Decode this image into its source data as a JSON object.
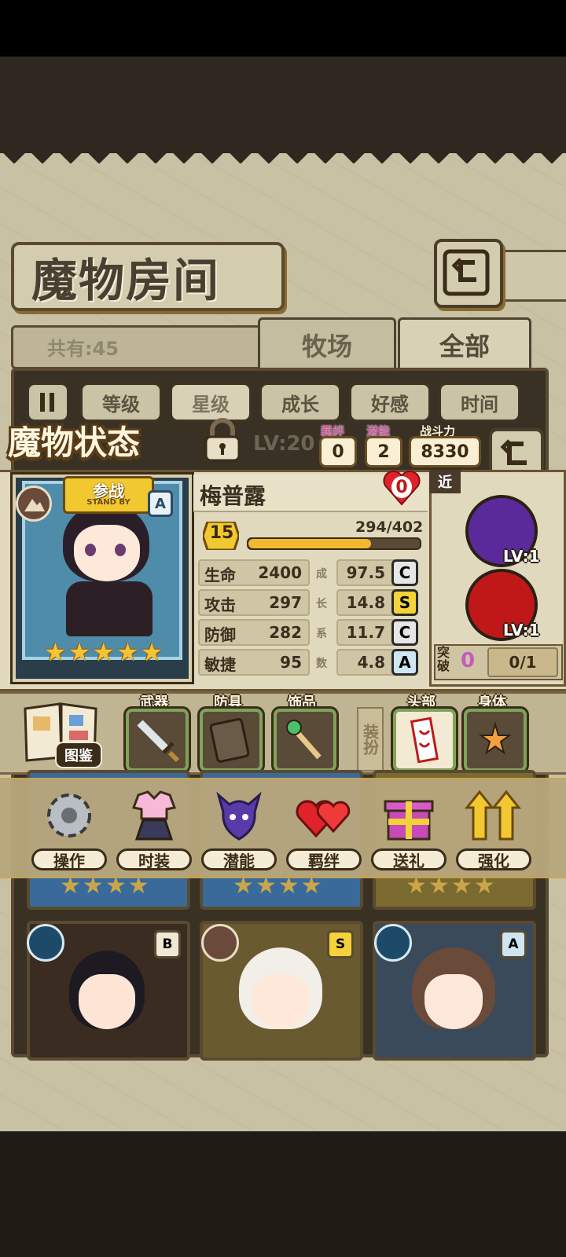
{
  "page": {
    "title": "魔物房间",
    "count_label": "共有:45",
    "tabs": [
      {
        "label": "牧场"
      },
      {
        "label": "全部"
      }
    ],
    "sort_buttons": [
      {
        "label": "等级"
      },
      {
        "label": "星级"
      },
      {
        "label": "成长"
      },
      {
        "label": "好感"
      },
      {
        "label": "时间"
      }
    ]
  },
  "status": {
    "title": "魔物状态",
    "level_label": "LV:20",
    "bond_label": "羁绊",
    "bond_value": "0",
    "potential_label": "潜能",
    "potential_value": "2",
    "power_label": "战斗力",
    "power_value": "8330",
    "standby_main": "参战",
    "standby_sub": "STAND BY",
    "rank": "A",
    "stars": 5,
    "name": "梅普露",
    "affection": "0",
    "level": "15",
    "exp_text": "294/402",
    "exp_fraction": 0.73,
    "stats": [
      {
        "label": "生命",
        "value": "2400"
      },
      {
        "label": "攻击",
        "value": "297"
      },
      {
        "label": "防御",
        "value": "282"
      },
      {
        "label": "敏捷",
        "value": "95"
      }
    ],
    "growth_caption": [
      "成",
      "长",
      "系",
      "数"
    ],
    "growth": [
      {
        "value": "97.5",
        "grade": "C",
        "color": "#e6e6e6"
      },
      {
        "value": "14.8",
        "grade": "S",
        "color": "#f3d23a"
      },
      {
        "value": "11.7",
        "grade": "C",
        "color": "#e6e6e6"
      },
      {
        "value": "4.8",
        "grade": "A",
        "color": "#cfe6f2"
      }
    ],
    "skill_tag": "近",
    "skills": [
      {
        "lv": "LV:1",
        "color": "#5a2a9a"
      },
      {
        "lv": "LV:1",
        "color": "#c01818"
      }
    ],
    "breakthrough_label": "突破",
    "breakthrough_value": "0",
    "breakthrough_progress": "0/1"
  },
  "equipment": {
    "book_label": "图鉴",
    "slots": [
      {
        "label": "武器"
      },
      {
        "label": "防具"
      },
      {
        "label": "饰品"
      }
    ],
    "dress_label": "装扮",
    "dress_slots": [
      {
        "label": "头部"
      },
      {
        "label": "身体"
      }
    ]
  },
  "actions": [
    {
      "label": "操作",
      "icon": "gear-icon"
    },
    {
      "label": "时装",
      "icon": "outfit-icon"
    },
    {
      "label": "潜能",
      "icon": "potential-icon"
    },
    {
      "label": "羁绊",
      "icon": "hearts-icon"
    },
    {
      "label": "送礼",
      "icon": "gift-icon"
    },
    {
      "label": "强化",
      "icon": "arrow-up-icon"
    }
  ],
  "cards": [
    {
      "rank": "B",
      "element": "water"
    },
    {
      "rank": "S",
      "element": "mountain"
    },
    {
      "rank": "A",
      "element": "water"
    }
  ]
}
